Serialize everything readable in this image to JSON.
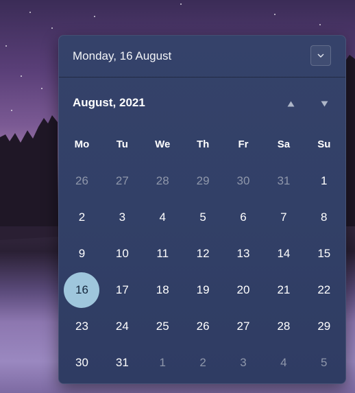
{
  "header": {
    "date_text": "Monday, 16 August"
  },
  "calendar": {
    "month_title": "August, 2021",
    "weekdays": [
      "Mo",
      "Tu",
      "We",
      "Th",
      "Fr",
      "Sa",
      "Su"
    ],
    "weeks": [
      [
        {
          "d": "26",
          "m": true
        },
        {
          "d": "27",
          "m": true
        },
        {
          "d": "28",
          "m": true
        },
        {
          "d": "29",
          "m": true
        },
        {
          "d": "30",
          "m": true
        },
        {
          "d": "31",
          "m": true
        },
        {
          "d": "1"
        }
      ],
      [
        {
          "d": "2"
        },
        {
          "d": "3"
        },
        {
          "d": "4"
        },
        {
          "d": "5"
        },
        {
          "d": "6"
        },
        {
          "d": "7"
        },
        {
          "d": "8"
        }
      ],
      [
        {
          "d": "9"
        },
        {
          "d": "10"
        },
        {
          "d": "11"
        },
        {
          "d": "12"
        },
        {
          "d": "13"
        },
        {
          "d": "14"
        },
        {
          "d": "15"
        }
      ],
      [
        {
          "d": "16",
          "today": true
        },
        {
          "d": "17"
        },
        {
          "d": "18"
        },
        {
          "d": "19"
        },
        {
          "d": "20"
        },
        {
          "d": "21"
        },
        {
          "d": "22"
        }
      ],
      [
        {
          "d": "23"
        },
        {
          "d": "24"
        },
        {
          "d": "25"
        },
        {
          "d": "26"
        },
        {
          "d": "27"
        },
        {
          "d": "28"
        },
        {
          "d": "29"
        }
      ],
      [
        {
          "d": "30"
        },
        {
          "d": "31"
        },
        {
          "d": "1",
          "m": true
        },
        {
          "d": "2",
          "m": true
        },
        {
          "d": "3",
          "m": true
        },
        {
          "d": "4",
          "m": true
        },
        {
          "d": "5",
          "m": true
        }
      ]
    ]
  },
  "icons": {
    "collapse": "chevron-down-icon",
    "prev": "triangle-up-icon",
    "next": "triangle-down-icon"
  },
  "colors": {
    "flyout_bg": "#324067",
    "today_bg": "#9fc6dc",
    "muted_text": "#8f97ab"
  }
}
